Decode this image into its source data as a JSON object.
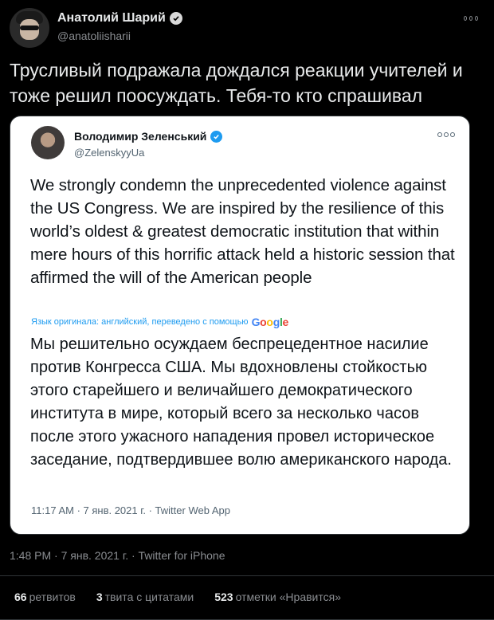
{
  "author": {
    "name": "Анатолий Шарий",
    "handle": "@anatoliisharii"
  },
  "tweet": {
    "text": "Трусливый подражала дождался реакции учителей и тоже решил поосуждать. Тебя-то кто спрашивал",
    "timestamp": "1:48 PM · 7 янв. 2021 г. · Twitter for iPhone"
  },
  "quoted": {
    "name": "Володимир Зеленський",
    "handle": "@ZelenskyyUa",
    "text": "We strongly condemn the unprecedented violence against the US Congress. We are inspired by the resilience of this world’s oldest & greatest democratic institution that within mere hours of this horrific  attack held a historic session that affirmed the will of the American people",
    "translation_note": "Язык оригинала: английский, переведено с помощью",
    "translation_provider": "Google",
    "translated_text": "Мы решительно осуждаем беспрецедентное насилие против Конгресса США. Мы вдохновлены стойкостью этого старейшего и величайшего демократического института в мире, который всего за несколько часов после этого ужасного нападения провел историческое заседание, подтвердившее волю американского народа.",
    "timestamp": "11:17 AM · 7 янв. 2021 г. · Twitter Web App"
  },
  "stats": {
    "retweets_count": "66",
    "retweets_label": "ретвитов",
    "quotes_count": "3",
    "quotes_label": "твита с цитатами",
    "likes_count": "523",
    "likes_label": "отметки «Нравится»"
  },
  "colors": {
    "background": "#000000",
    "accent": "#1d9bf0",
    "quote_card": "#ffffff"
  }
}
